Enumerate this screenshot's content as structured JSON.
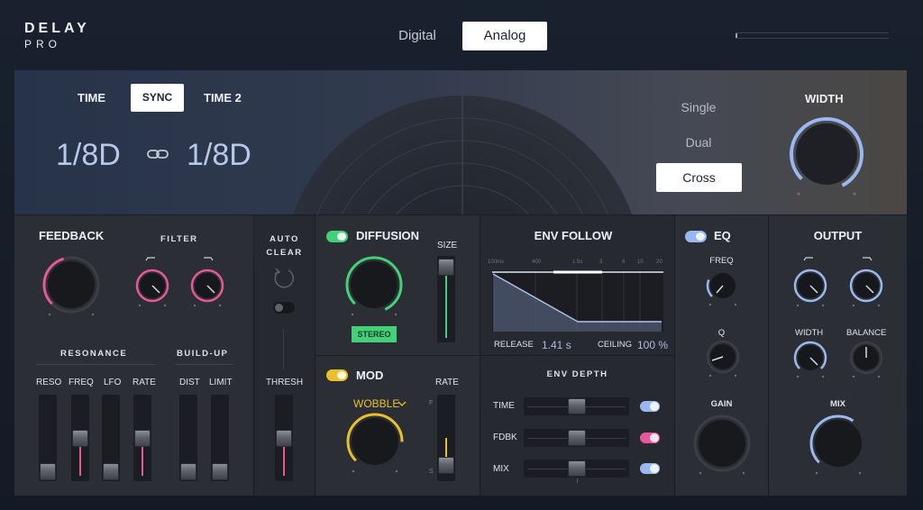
{
  "header": {
    "logo_line1": "DELAY",
    "logo_line2": "PRO",
    "modes": [
      "Digital",
      "Analog"
    ],
    "active_mode": "Analog"
  },
  "time": {
    "time_label": "TIME",
    "sync_label": "SYNC",
    "time2_label": "TIME 2",
    "value1": "1/8D",
    "value2": "1/8D",
    "link_icon": "link-icon"
  },
  "routing": {
    "options": [
      "Single",
      "Dual",
      "Cross"
    ],
    "selected": "Cross"
  },
  "width": {
    "label": "WIDTH"
  },
  "feedback": {
    "title": "FEEDBACK",
    "filter_label": "FILTER",
    "resonance_label": "RESONANCE",
    "buildup_label": "BUILD-UP",
    "sliders": [
      "RESO",
      "FREQ",
      "LFO",
      "RATE",
      "DIST",
      "LIMIT"
    ]
  },
  "autoclear": {
    "line1": "AUTO",
    "line2": "CLEAR",
    "thresh_label": "THRESH"
  },
  "diffusion": {
    "title": "DIFFUSION",
    "size_label": "SIZE",
    "stereo_label": "STEREO"
  },
  "mod": {
    "title": "MOD",
    "rate_label": "RATE",
    "waveform": "WOBBLE",
    "rate_top_marker": "F",
    "rate_bottom_marker": "S"
  },
  "env_follow": {
    "title": "ENV FOLLOW",
    "scale": [
      "100ms",
      "400",
      "1.5s",
      "3",
      "6",
      "10",
      "20"
    ],
    "release_label": "RELEASE",
    "release_value": "1.41 s",
    "ceiling_label": "CEILING",
    "ceiling_value": "100 %"
  },
  "env_depth": {
    "title": "ENV DEPTH",
    "rows": [
      "TIME",
      "FDBK",
      "MIX"
    ]
  },
  "eq": {
    "title": "EQ",
    "freq_label": "FREQ",
    "q_label": "Q",
    "gain_label": "GAIN"
  },
  "output": {
    "title": "OUTPUT",
    "width_label": "WIDTH",
    "balance_label": "BALANCE",
    "mix_label": "MIX"
  },
  "colors": {
    "accent_blue": "#9ab8f0",
    "pink": "#e6579b",
    "green": "#44d07a",
    "yellow": "#e8c02c"
  }
}
